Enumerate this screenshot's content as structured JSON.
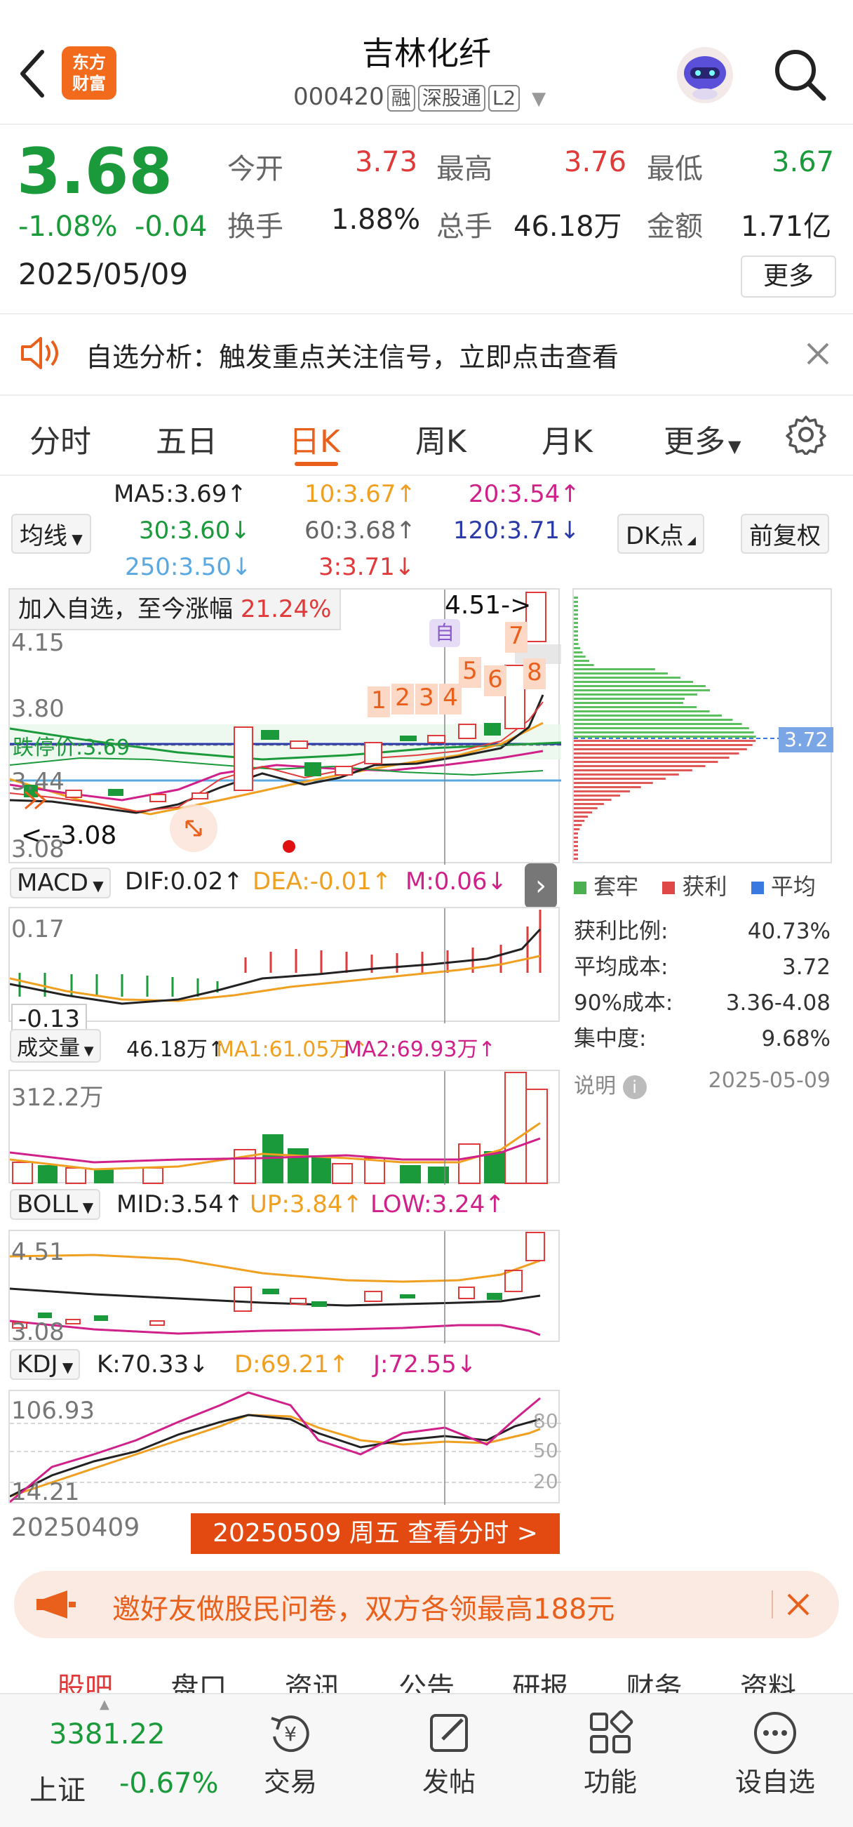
{
  "header": {
    "title": "吉林化纤",
    "code": "000420",
    "tags": [
      "融",
      "深股通",
      "L2"
    ],
    "logo_text_1": "东方",
    "logo_text_2": "财富"
  },
  "quote": {
    "price": "3.68",
    "change_pct": "-1.08%",
    "change": "-0.04",
    "date": "2025/05/09",
    "open_label": "今开",
    "open": "3.73",
    "high_label": "最高",
    "high": "3.76",
    "low_label": "最低",
    "low": "3.67",
    "turnover_label": "换手",
    "turnover": "1.88%",
    "volume_label": "总手",
    "volume": "46.18万",
    "amount_label": "金额",
    "amount": "1.71亿",
    "more_button": "更多"
  },
  "notice": {
    "text": "自选分析：触发重点关注信号，立即点击查看"
  },
  "tabs": [
    "分时",
    "五日",
    "日K",
    "周K",
    "月K",
    "更多"
  ],
  "ma": {
    "selector": "均线",
    "ma5": "MA5:3.69↑",
    "ma10": "10:3.67↑",
    "ma20": "20:3.54↑",
    "ma30": "30:3.60↓",
    "ma60": "60:3.68↑",
    "ma120": "120:3.71↓",
    "ma250": "250:3.50↓",
    "ma3": "3:3.71↓",
    "dk_button": "DK点",
    "fq_button": "前复权"
  },
  "kline": {
    "add_watch_text": "加入自选，至今涨幅",
    "add_watch_pct": "21.24%",
    "high_marker": "4.51->",
    "low_marker": "<--3.08",
    "y_top": "4.15",
    "y_mid": "3.80",
    "y_low": "3.44",
    "y_bottom": "3.08",
    "support_label": "跌停价:3.69",
    "self_mark": "自",
    "seq_numbers": [
      "1",
      "2",
      "3",
      "4",
      "5",
      "6",
      "7",
      "8"
    ]
  },
  "chips": {
    "price_tag": "3.72",
    "legend": [
      "套牢",
      "获利",
      "平均"
    ],
    "profit_ratio_label": "获利比例:",
    "profit_ratio": "40.73%",
    "avg_cost_label": "平均成本:",
    "avg_cost": "3.72",
    "cost90_label": "90%成本:",
    "cost90": "3.36-4.08",
    "concentration_label": "集中度:",
    "concentration": "9.68%",
    "explain_label": "说明",
    "date": "2025-05-09"
  },
  "macd": {
    "selector": "MACD",
    "dif": "DIF:0.02↑",
    "dea": "DEA:-0.01↑",
    "m": "M:0.06↓",
    "y_top": "0.17",
    "y_bottom": "-0.13"
  },
  "volume": {
    "selector": "成交量",
    "vol": "46.18万↑",
    "ma1": "MA1:61.05万↑",
    "ma2": "MA2:69.93万↑",
    "y_top": "312.2万"
  },
  "boll": {
    "selector": "BOLL",
    "mid": "MID:3.54↑",
    "up": "UP:3.84↑",
    "low": "LOW:3.24↑",
    "y_top": "4.51",
    "y_bottom": "3.08"
  },
  "kdj": {
    "selector": "KDJ",
    "k": "K:70.33↓",
    "d": "D:69.21↑",
    "j": "J:72.55↓",
    "y_top": "106.93",
    "y_bottom": "14.21",
    "levels": [
      "80",
      "50",
      "20"
    ]
  },
  "footer_chart": {
    "start_date": "20250409",
    "cursor_button": "20250509 周五 查看分时 >"
  },
  "promo": {
    "text": "邀好友做股民问卷，双方各领最高188元"
  },
  "info_tabs": [
    "股吧",
    "盘口",
    "资讯",
    "公告",
    "研报",
    "财务",
    "资料"
  ],
  "bottom_nav": {
    "index_value": "3381.22",
    "index_name": "上证",
    "index_change": "-0.67%",
    "items": [
      "交易",
      "发帖",
      "功能",
      "设自选"
    ]
  },
  "colors": {
    "up": "#e03a3a",
    "down": "#1a9a3a",
    "accent": "#e8601c",
    "ma5": "#222222",
    "ma10": "#f0a020",
    "ma20": "#d0208a",
    "ma30": "#1a9a3a"
  }
}
